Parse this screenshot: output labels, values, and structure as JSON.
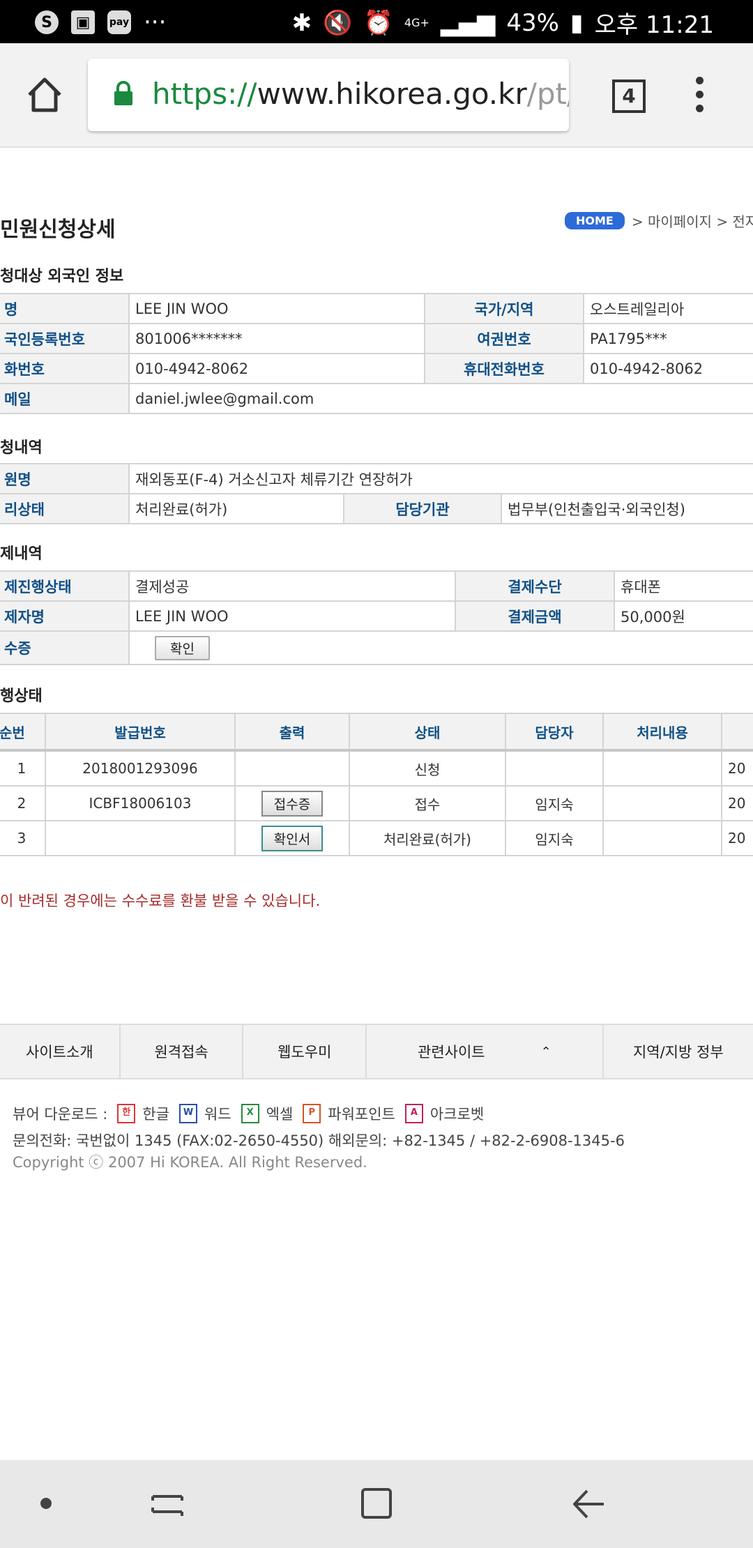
{
  "status_bar": {
    "apps": [
      "S",
      "▣",
      "pay",
      "···"
    ],
    "battery": "43%",
    "time": "오후 11:21",
    "network": "4G+"
  },
  "browser": {
    "url_scheme": "https://",
    "url_host": "www.hikorea.go.kr",
    "url_path": "/pt/N",
    "tab_count": "4"
  },
  "page": {
    "title": "민원신청상세",
    "breadcrumb": {
      "home": "HOME",
      "path": "> 마이페이지 > 전자민"
    }
  },
  "applicant": {
    "section_title": "청대상 외국인 정보",
    "name_label": "명",
    "name": "LEE JIN WOO",
    "country_label": "국가/지역",
    "country": "오스트레일리아",
    "reg_label": "국인등록번호",
    "reg_no": "801006*******",
    "passport_label": "여권번호",
    "passport": "PA1795***",
    "phone_label": "화번호",
    "phone": "010-4942-8062",
    "mobile_label": "휴대전화번호",
    "mobile": "010-4942-8062",
    "email_label": "메일",
    "email": "daniel.jwlee@gmail.com"
  },
  "application": {
    "section_title": "청내역",
    "petition_label": "원명",
    "petition": "재외동포(F-4) 거소신고자 체류기간 연장허가",
    "status_label": "리상태",
    "status": "처리완료(허가)",
    "agency_label": "담당기관",
    "agency": "법무부(인천출입국·외국인청)"
  },
  "payment": {
    "section_title": "제내역",
    "progress_label": "제진행상태",
    "progress": "결제성공",
    "method_label": "결제수단",
    "method": "휴대폰",
    "payer_label": "제자명",
    "payer": "LEE JIN WOO",
    "amount_label": "결제금액",
    "amount": "50,000원",
    "receipt_label": "수증",
    "receipt_button": "확인"
  },
  "progress_table": {
    "section_title": "행상태",
    "headers": [
      "순번",
      "발급번호",
      "출력",
      "상태",
      "담당자",
      "처리내용",
      ""
    ],
    "rows": [
      {
        "no": "1",
        "issue_no": "2018001293096",
        "print": "",
        "state": "신청",
        "officer": "",
        "detail": "",
        "date": "20"
      },
      {
        "no": "2",
        "issue_no": "ICBF18006103",
        "print": "접수증",
        "state": "접수",
        "officer": "임지숙",
        "detail": "",
        "date": "20"
      },
      {
        "no": "3",
        "issue_no": "",
        "print": "확인서",
        "state": "처리완료(허가)",
        "officer": "임지숙",
        "detail": "",
        "date": "20"
      }
    ]
  },
  "notice": "이 반려된 경우에는 수수료를 환불 받을 수 있습니다.",
  "footer_nav": {
    "items": [
      "사이트소개",
      "원격접속",
      "웹도우미",
      "관련사이트",
      "지역/지방 정부"
    ]
  },
  "footer": {
    "viewer_label": "뷰어 다운로드 :",
    "viewers": [
      "한글",
      "워드",
      "엑셀",
      "파워포인트",
      "아크로벳"
    ],
    "contact": "문의전화: 국번없이 1345 (FAX:02-2650-4550) 해외문의: +82-1345 / +82-2-6908-1345-6",
    "copyright": "Copyright ⓒ 2007 Hi KOREA. All Right Reserved."
  },
  "colors": {
    "label_blue": "#0f4f86",
    "url_green": "#1a8a3e",
    "notice_red": "#a52a2a",
    "home_badge": "#2d6bd8"
  }
}
